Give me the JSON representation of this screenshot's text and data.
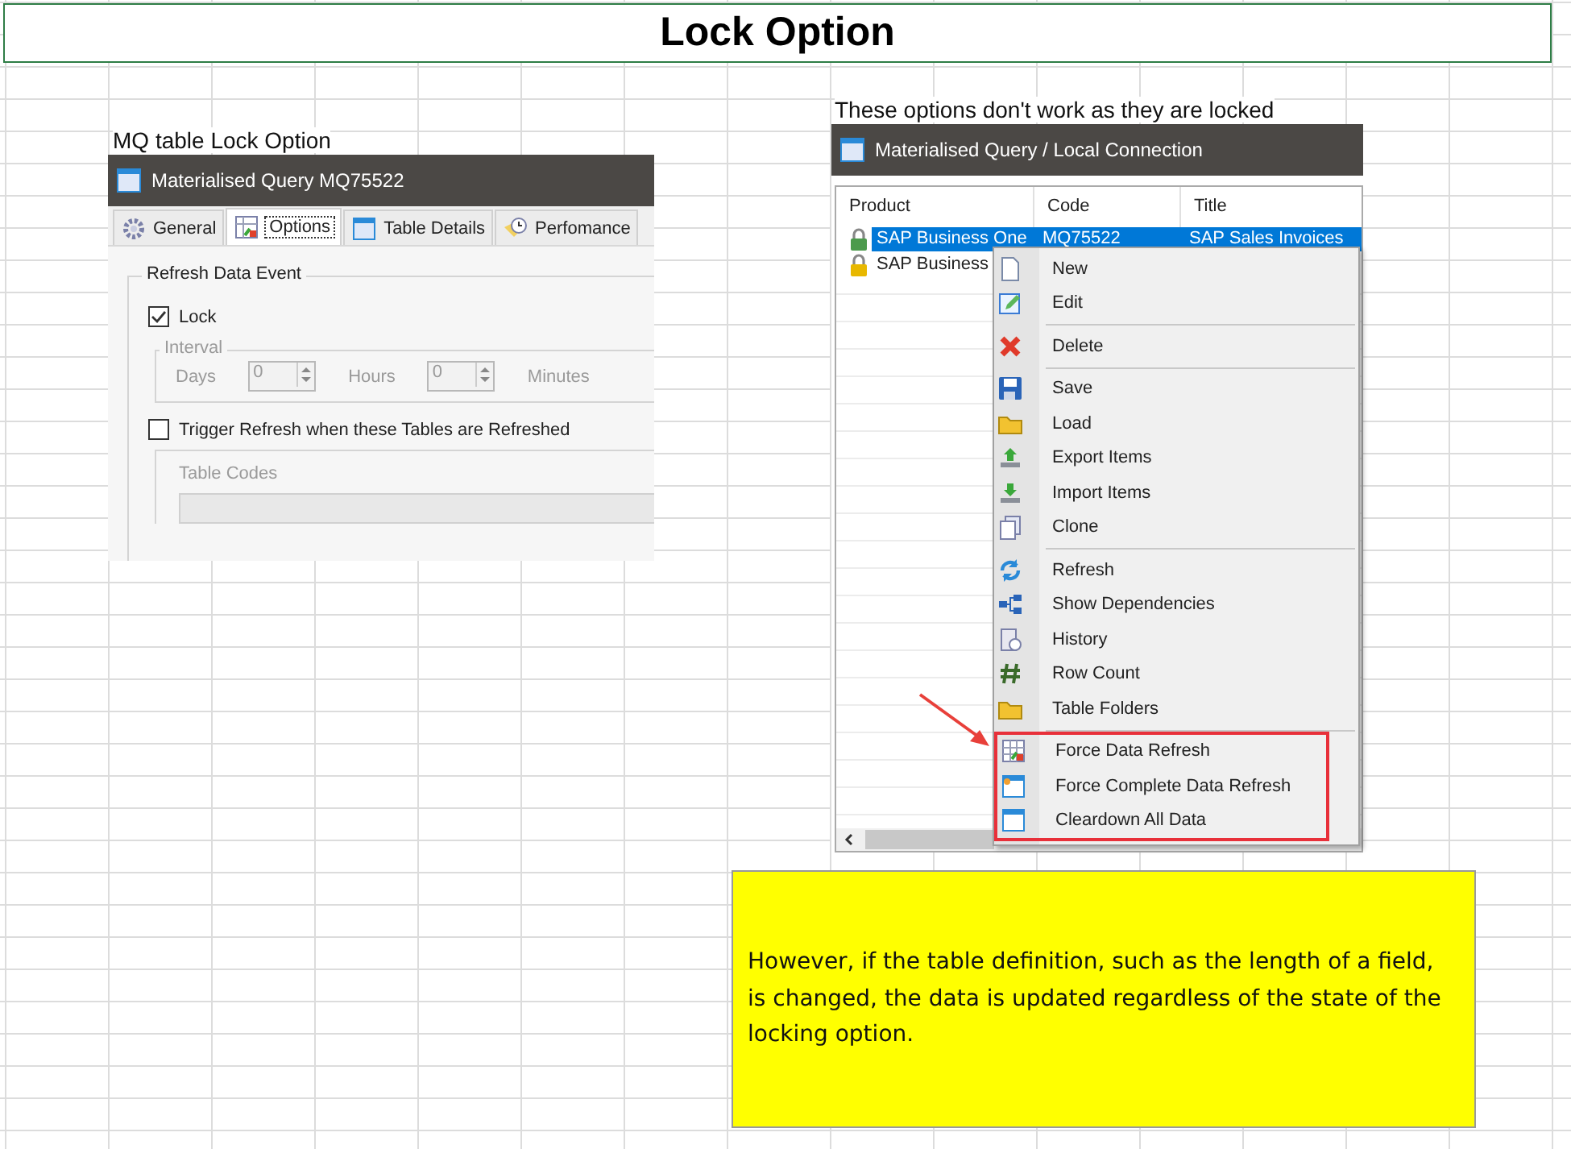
{
  "title": "Lock Option",
  "left": {
    "caption": "MQ table Lock Option",
    "window_title": "Materialised Query MQ75522",
    "tabs": [
      {
        "label": "General",
        "selected": false
      },
      {
        "label": "Options",
        "selected": true
      },
      {
        "label": "Table Details",
        "selected": false
      },
      {
        "label": "Perfomance",
        "selected": false
      }
    ],
    "group_title": "Refresh Data Event",
    "lock": {
      "label": "Lock",
      "checked": true
    },
    "interval": {
      "title": "Interval",
      "disabled": true,
      "days_label": "Days",
      "days": "0",
      "hours_label": "Hours",
      "hours": "0",
      "minutes_label": "Minutes"
    },
    "trigger": {
      "label": "Trigger Refresh when these Tables are Refreshed",
      "checked": false
    },
    "table_codes_label": "Table Codes"
  },
  "right": {
    "caption": "These options don't work as they are locked",
    "window_title": "Materialised Query / Local Connection",
    "columns": [
      "Product",
      "Code",
      "Title"
    ],
    "rows": [
      {
        "product": "SAP Business One",
        "code": "MQ75522",
        "title": "SAP Sales Invoices",
        "selected": true,
        "color": "#4c9a4c"
      },
      {
        "product": "SAP Business",
        "selected": false,
        "color": "#e8b800"
      }
    ],
    "menu": [
      {
        "highlighted": false,
        "items": [
          "New",
          "Edit"
        ]
      },
      {
        "highlighted": false,
        "items": [
          "Delete"
        ]
      },
      {
        "highlighted": false,
        "items": [
          "Save",
          "Load",
          "Export Items",
          "Import Items",
          "Clone"
        ]
      },
      {
        "highlighted": false,
        "items": [
          "Refresh",
          "Show Dependencies",
          "History",
          "Row Count",
          "Table Folders"
        ]
      },
      {
        "highlighted": true,
        "items": [
          "Force Data Refresh",
          "Force Complete Data Refresh",
          "Cleardown All Data"
        ]
      }
    ]
  },
  "note": "However, if the table definition, such as the length of a field, is changed, the data is updated regardless of the state of the locking option."
}
